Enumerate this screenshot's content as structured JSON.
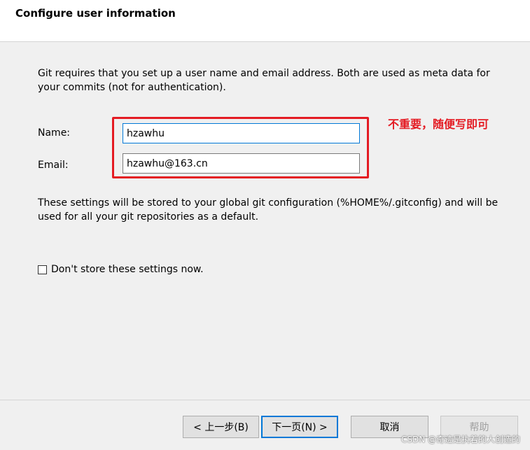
{
  "header": {
    "title": "Configure user information"
  },
  "intro_text": "Git requires that you set up a user name and email address. Both are used as meta data for your commits (not for authentication).",
  "form": {
    "name_label": "Name:",
    "name_value": "hzawhu",
    "email_label": "Email:",
    "email_value": "hzawhu@163.cn"
  },
  "annotation": {
    "text": "不重要，随便写即可",
    "color": "#e41b23"
  },
  "info_text": "These settings will be stored to your global git configuration (%HOME%/.gitconfig) and will be used for all your git repositories as a default.",
  "checkbox": {
    "label": "Don't store these settings now.",
    "checked": false
  },
  "footer": {
    "back_label": "< 上一步(B)",
    "next_label": "下一页(N) >",
    "cancel_label": "取消",
    "help_label": "帮助"
  },
  "watermark": "CSDN @奇迹是执着的人创造的",
  "colors": {
    "accent": "#0078d7",
    "highlight": "#e41b23"
  }
}
